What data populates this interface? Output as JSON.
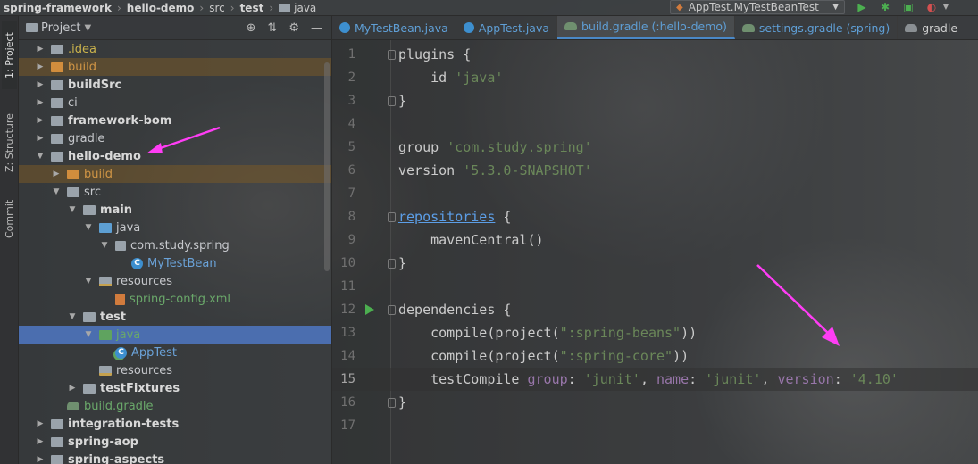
{
  "breadcrumb": {
    "items": [
      {
        "label": "spring-framework",
        "bold": true
      },
      {
        "label": "hello-demo",
        "bold": true
      },
      {
        "label": "src",
        "bold": false
      },
      {
        "label": "test",
        "bold": true
      },
      {
        "label": "java",
        "bold": false
      }
    ]
  },
  "toolbar": {
    "run_config": "AppTest.MyTestBeanTest",
    "icons": [
      "run-icon",
      "debug-icon",
      "coverage-icon"
    ]
  },
  "left_strip": {
    "tabs": [
      {
        "label": "1: Project",
        "active": true
      },
      {
        "label": "Z: Structure",
        "active": false
      },
      {
        "label": "Commit",
        "active": false
      }
    ]
  },
  "project_panel": {
    "title": "Project",
    "header_icons": [
      "locate-icon",
      "collapse-icon",
      "gear-icon",
      "minimize-icon"
    ],
    "tree": [
      {
        "label": ".idea",
        "style": "yellow",
        "icon": "folder-grey",
        "expanded": false
      },
      {
        "label": "build",
        "style": "orange",
        "icon": "folder-orange",
        "expanded": false,
        "highlight": "orange"
      },
      {
        "label": "buildSrc",
        "style": "bold",
        "icon": "folder-grey",
        "expanded": false
      },
      {
        "label": "ci",
        "style": "normal",
        "icon": "folder-grey",
        "expanded": false
      },
      {
        "label": "framework-bom",
        "style": "bold",
        "icon": "folder-grey",
        "expanded": false
      },
      {
        "label": "gradle",
        "style": "normal",
        "icon": "folder-grey",
        "expanded": false
      },
      {
        "label": "hello-demo",
        "style": "bold",
        "icon": "folder-grey",
        "expanded": true
      },
      {
        "label": "build",
        "style": "orange",
        "icon": "folder-orange",
        "expanded": false,
        "highlight": "orange"
      },
      {
        "label": "src",
        "style": "normal",
        "icon": "folder-grey",
        "expanded": true
      },
      {
        "label": "main",
        "style": "bold",
        "icon": "folder-grey",
        "expanded": true
      },
      {
        "label": "java",
        "style": "normal",
        "icon": "folder-blue",
        "expanded": true
      },
      {
        "label": "com.study.spring",
        "style": "normal",
        "icon": "package",
        "expanded": true
      },
      {
        "label": "MyTestBean",
        "style": "blue",
        "icon": "class"
      },
      {
        "label": "resources",
        "style": "normal",
        "icon": "folder-res",
        "expanded": true
      },
      {
        "label": "spring-config.xml",
        "style": "green",
        "icon": "xml"
      },
      {
        "label": "test",
        "style": "bold",
        "icon": "folder-grey",
        "expanded": true
      },
      {
        "label": "java",
        "style": "green",
        "icon": "folder-green",
        "expanded": true,
        "highlight": "blue"
      },
      {
        "label": "AppTest",
        "style": "blue",
        "icon": "class-test"
      },
      {
        "label": "resources",
        "style": "normal",
        "icon": "folder-res"
      },
      {
        "label": "testFixtures",
        "style": "bold",
        "icon": "folder-grey",
        "expanded": false
      },
      {
        "label": "build.gradle",
        "style": "green",
        "icon": "gradle"
      },
      {
        "label": "integration-tests",
        "style": "bold",
        "icon": "folder-grey",
        "expanded": false
      },
      {
        "label": "spring-aop",
        "style": "bold",
        "icon": "folder-grey",
        "expanded": false
      },
      {
        "label": "spring-aspects",
        "style": "bold",
        "icon": "folder-grey",
        "expanded": false
      }
    ]
  },
  "editor_tabs": [
    {
      "label": "MyTestBean.java",
      "icon": "class-icon",
      "active": false
    },
    {
      "label": "AppTest.java",
      "icon": "class-icon",
      "active": false
    },
    {
      "label": "build.gradle (:hello-demo)",
      "icon": "gradle-icon",
      "active": true
    },
    {
      "label": "settings.gradle (spring)",
      "icon": "gradle-icon",
      "active": false
    },
    {
      "label": "gradle",
      "icon": "gradle-icon",
      "active": false
    }
  ],
  "editor": {
    "current_line": 15,
    "lines": [
      {
        "n": "1",
        "segs": [
          {
            "t": "plugins {",
            "c": ""
          }
        ]
      },
      {
        "n": "2",
        "segs": [
          {
            "t": "    id ",
            "c": ""
          },
          {
            "t": "'java'",
            "c": "str"
          }
        ]
      },
      {
        "n": "3",
        "segs": [
          {
            "t": "}",
            "c": ""
          }
        ]
      },
      {
        "n": "4",
        "segs": []
      },
      {
        "n": "5",
        "segs": [
          {
            "t": "group ",
            "c": ""
          },
          {
            "t": "'com.study.spring'",
            "c": "str"
          }
        ]
      },
      {
        "n": "6",
        "segs": [
          {
            "t": "version ",
            "c": ""
          },
          {
            "t": "'5.3.0-SNAPSHOT'",
            "c": "str"
          }
        ]
      },
      {
        "n": "7",
        "segs": []
      },
      {
        "n": "8",
        "segs": [
          {
            "t": "repositories",
            "c": "link"
          },
          {
            "t": " {",
            "c": ""
          }
        ]
      },
      {
        "n": "9",
        "segs": [
          {
            "t": "    mavenCentral()",
            "c": ""
          }
        ]
      },
      {
        "n": "10",
        "segs": [
          {
            "t": "}",
            "c": ""
          }
        ]
      },
      {
        "n": "11",
        "segs": []
      },
      {
        "n": "12",
        "segs": [
          {
            "t": "dependencies {",
            "c": ""
          }
        ]
      },
      {
        "n": "13",
        "segs": [
          {
            "t": "    compile(project(",
            "c": ""
          },
          {
            "t": "\":spring-beans\"",
            "c": "str"
          },
          {
            "t": "))",
            "c": ""
          }
        ]
      },
      {
        "n": "14",
        "segs": [
          {
            "t": "    compile(project(",
            "c": ""
          },
          {
            "t": "\":spring-core\"",
            "c": "str"
          },
          {
            "t": "))",
            "c": ""
          }
        ]
      },
      {
        "n": "15",
        "segs": [
          {
            "t": "    testCompile ",
            "c": ""
          },
          {
            "t": "group",
            "c": "key"
          },
          {
            "t": ": ",
            "c": ""
          },
          {
            "t": "'junit'",
            "c": "str"
          },
          {
            "t": ", ",
            "c": ""
          },
          {
            "t": "name",
            "c": "key"
          },
          {
            "t": ": ",
            "c": ""
          },
          {
            "t": "'junit'",
            "c": "str"
          },
          {
            "t": ", ",
            "c": ""
          },
          {
            "t": "version",
            "c": "key"
          },
          {
            "t": ": ",
            "c": ""
          },
          {
            "t": "'4.10'",
            "c": "str"
          }
        ]
      },
      {
        "n": "16",
        "segs": [
          {
            "t": "}",
            "c": ""
          }
        ]
      },
      {
        "n": "17",
        "segs": []
      }
    ]
  },
  "colors": {
    "accent": "#4a88c7",
    "string": "#6a8759",
    "keyword_param": "#9876aa",
    "annotation_arrow": "#ff3df5"
  }
}
